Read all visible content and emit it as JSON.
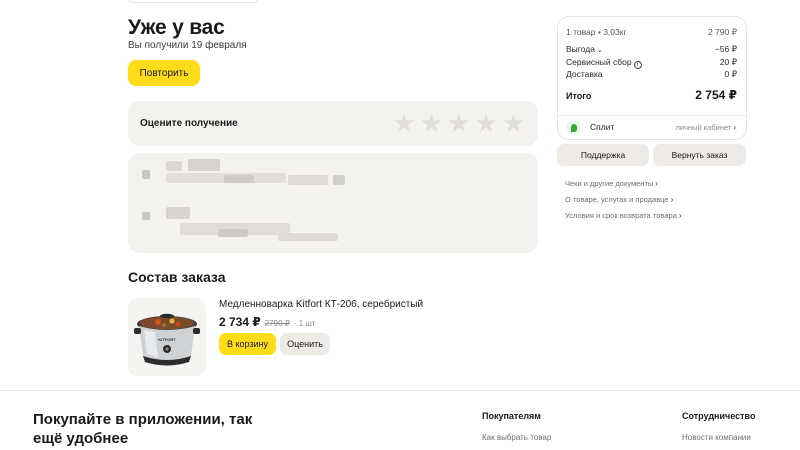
{
  "order_status": {
    "title": "Уже у вас",
    "subtitle": "Вы получили 19 февраля",
    "repeat_button": "Повторить"
  },
  "rating": {
    "label": "Оцените получение",
    "stars_total": 5
  },
  "composition": {
    "title": "Состав заказа",
    "items": [
      {
        "name": "Медленноварка Kitfort КТ-206, серебристый",
        "price": "2 734 ₽",
        "old_price": "2790 ₽",
        "quantity": "· 1 шт",
        "thumb_brand": "KITFORT",
        "cart_button": "В корзину",
        "rate_button": "Оценить"
      }
    ]
  },
  "summary": {
    "items_line": "1 товар • 3,03кг",
    "items_price": "2 790 ₽",
    "rows": [
      {
        "label": "Выгода",
        "value": "−56 ₽",
        "icon": "chevron-down-icon"
      },
      {
        "label": "Сервисный сбор",
        "value": "20 ₽",
        "icon": "info-icon"
      },
      {
        "label": "Доставка",
        "value": "0 ₽",
        "icon": ""
      }
    ],
    "total_label": "Итого",
    "total_value": "2 754 ₽",
    "split": {
      "label": "Сплит",
      "link": "личный кабинет"
    }
  },
  "actions": {
    "support": "Поддержка",
    "return": "Вернуть заказ"
  },
  "info_links": [
    "Чеки и другие документы",
    "О товаре, услугах и продавце",
    "Условия и срок возврата товара"
  ],
  "footer": {
    "promo": "Покупайте в приложении, так ещё удобнее",
    "columns": [
      {
        "heading": "Покупателям",
        "link": "Как выбрать товар"
      },
      {
        "heading": "Сотрудничество",
        "link": "Новости компании"
      }
    ]
  },
  "colors": {
    "accent": "#ffdc1a",
    "card_bg": "#f4f2ef",
    "split_green": "#2faa3a"
  }
}
